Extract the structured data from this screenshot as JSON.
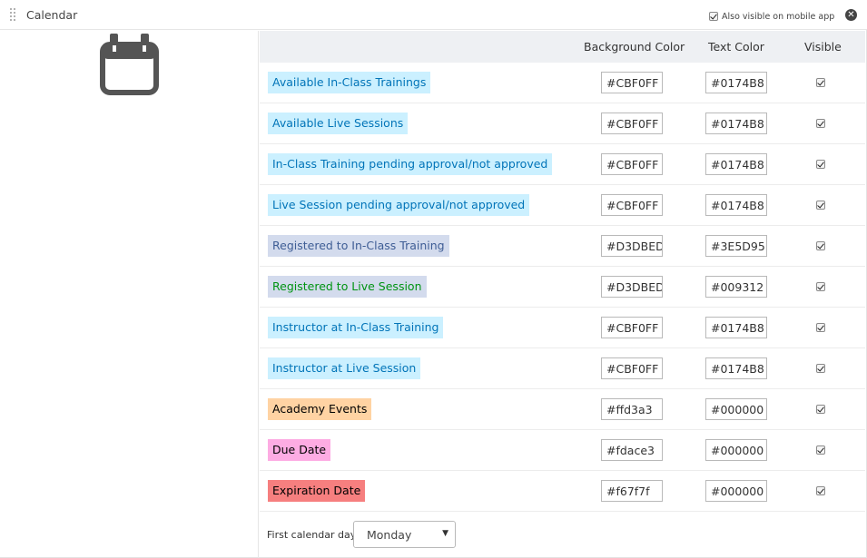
{
  "header": {
    "title": "Calendar",
    "mobile_label": "Also visible on mobile app"
  },
  "icons": {
    "drag": "drag-handle-icon",
    "close": "close-icon",
    "calendar": "calendar-icon",
    "check": "checkbox-checked-icon",
    "caret": "chevron-down-icon"
  },
  "table": {
    "col_bg": "Background Color",
    "col_text": "Text Color",
    "col_visible": "Visible"
  },
  "rows": [
    {
      "label": "Available In-Class Trainings",
      "bg": "#CBF0FF",
      "text": "#0174B8",
      "visible": true
    },
    {
      "label": "Available Live Sessions",
      "bg": "#CBF0FF",
      "text": "#0174B8",
      "visible": true
    },
    {
      "label": "In-Class Training pending approval/not approved",
      "bg": "#CBF0FF",
      "text": "#0174B8",
      "visible": true
    },
    {
      "label": "Live Session pending approval/not approved",
      "bg": "#CBF0FF",
      "text": "#0174B8",
      "visible": true
    },
    {
      "label": "Registered to In-Class Training",
      "bg": "#D3DBED",
      "text": "#3E5D95",
      "visible": true
    },
    {
      "label": "Registered to Live Session",
      "bg": "#D3DBED",
      "text": "#009312",
      "visible": true
    },
    {
      "label": "Instructor at In-Class Training",
      "bg": "#CBF0FF",
      "text": "#0174B8",
      "visible": true
    },
    {
      "label": "Instructor at Live Session",
      "bg": "#CBF0FF",
      "text": "#0174B8",
      "visible": true
    },
    {
      "label": "Academy Events",
      "bg": "#ffd3a3",
      "text": "#000000",
      "visible": true
    },
    {
      "label": "Due Date",
      "bg": "#fdace3",
      "text": "#000000",
      "visible": true
    },
    {
      "label": "Expiration Date",
      "bg": "#f67f7f",
      "text": "#000000",
      "visible": true
    }
  ],
  "footer": {
    "first_day_label": "First calendar day:",
    "first_day_value": "Monday"
  }
}
